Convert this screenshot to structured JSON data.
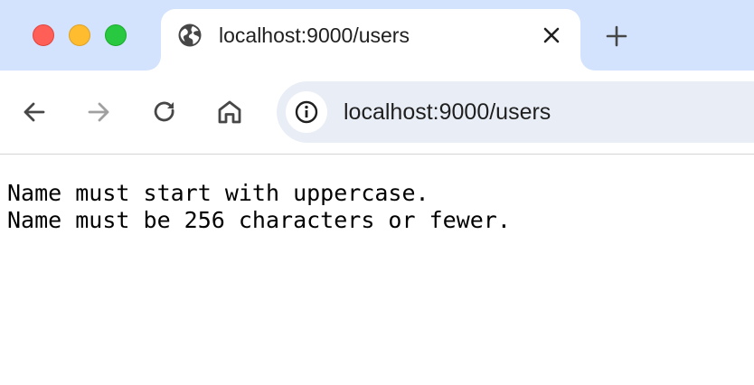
{
  "browser": {
    "tab": {
      "title": "localhost:9000/users",
      "favicon": "globe-icon"
    },
    "new_tab_icon": "plus-icon",
    "toolbar": {
      "back_icon": "arrow-left-icon",
      "forward_icon": "arrow-right-icon",
      "reload_icon": "reload-icon",
      "home_icon": "home-icon"
    },
    "address_bar": {
      "site_info_icon": "info-icon",
      "url": "localhost:9000/users"
    }
  },
  "page": {
    "lines": [
      "Name must start with uppercase.",
      "Name must be 256 characters or fewer."
    ]
  },
  "colors": {
    "tabstrip_bg": "#d3e3fd",
    "omnibox_bg": "#e9eef6",
    "traffic_close": "#ff5f57",
    "traffic_minimize": "#febc2e",
    "traffic_zoom": "#28c840"
  }
}
